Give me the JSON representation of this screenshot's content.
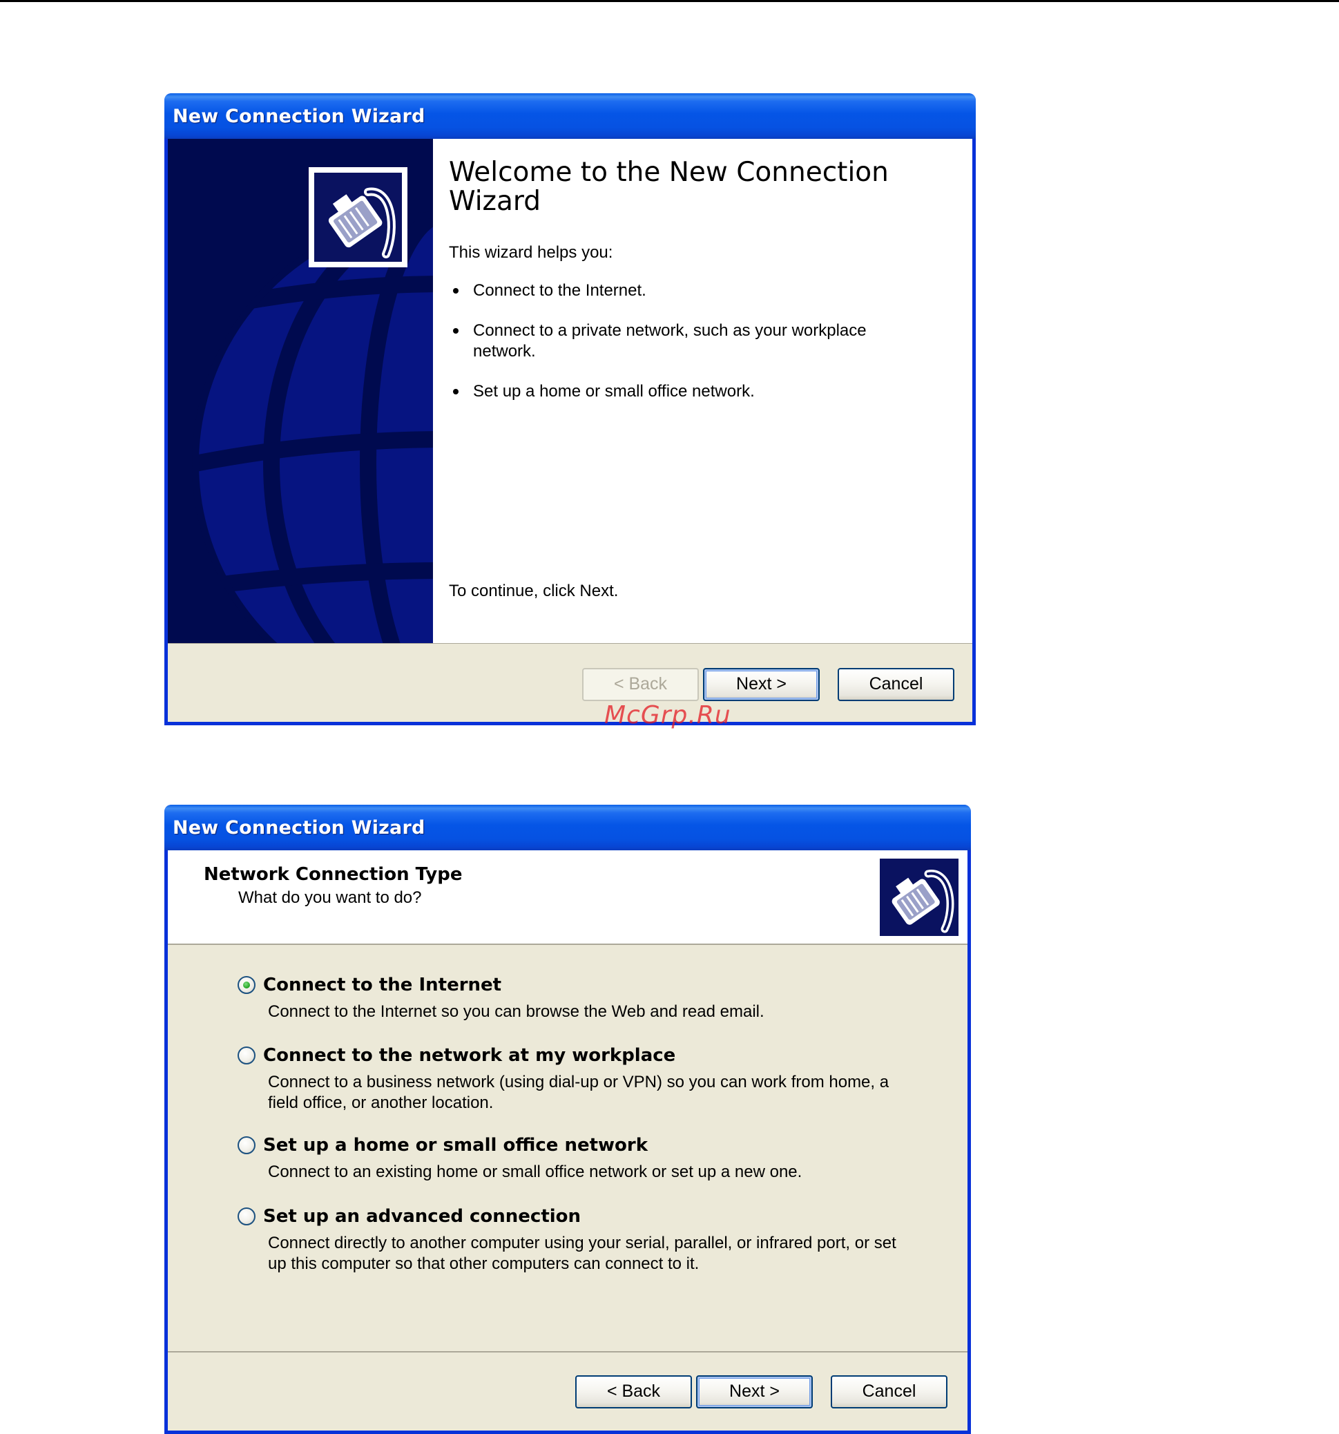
{
  "welcome_window": {
    "title": "New Connection Wizard",
    "heading": "Welcome to the New Connection Wizard",
    "intro": "This wizard helps you:",
    "bullets": [
      "Connect to the Internet.",
      "Connect to a private network, such as your workplace network.",
      "Set up a home or small office network."
    ],
    "continue_text": "To continue, click Next.",
    "buttons": {
      "back": "< Back",
      "next": "Next >",
      "cancel": "Cancel"
    },
    "back_enabled": false,
    "side_art_icon": "ethernet-plug-icon"
  },
  "type_window": {
    "title": "New Connection Wizard",
    "page_title": "Network Connection Type",
    "page_subtitle": "What do you want to do?",
    "header_icon": "ethernet-plug-icon",
    "selected_index": 0,
    "options": [
      {
        "label": "Connect to the Internet",
        "description": "Connect to the Internet so you can browse the Web and read email."
      },
      {
        "label": "Connect to the network at my workplace",
        "description": "Connect to a business network (using dial-up or VPN) so you can work from home, a field office, or another location."
      },
      {
        "label": "Set up a home or small office network",
        "description": "Connect to an existing home or small office network or set up a new one."
      },
      {
        "label": "Set up an advanced connection",
        "description": "Connect directly to another computer using your serial, parallel, or infrared port, or set up this computer so that other computers can connect to it."
      }
    ],
    "buttons": {
      "back": "< Back",
      "next": "Next >",
      "cancel": "Cancel"
    }
  },
  "watermark": "McGrp.Ru",
  "colors": {
    "titlebar": "#0555e6",
    "frame": "#0831d9",
    "side_panel": "#000a4f",
    "dialog_face": "#ece9d8",
    "radio_selected": "#21a121",
    "watermark": "#e31b23"
  }
}
